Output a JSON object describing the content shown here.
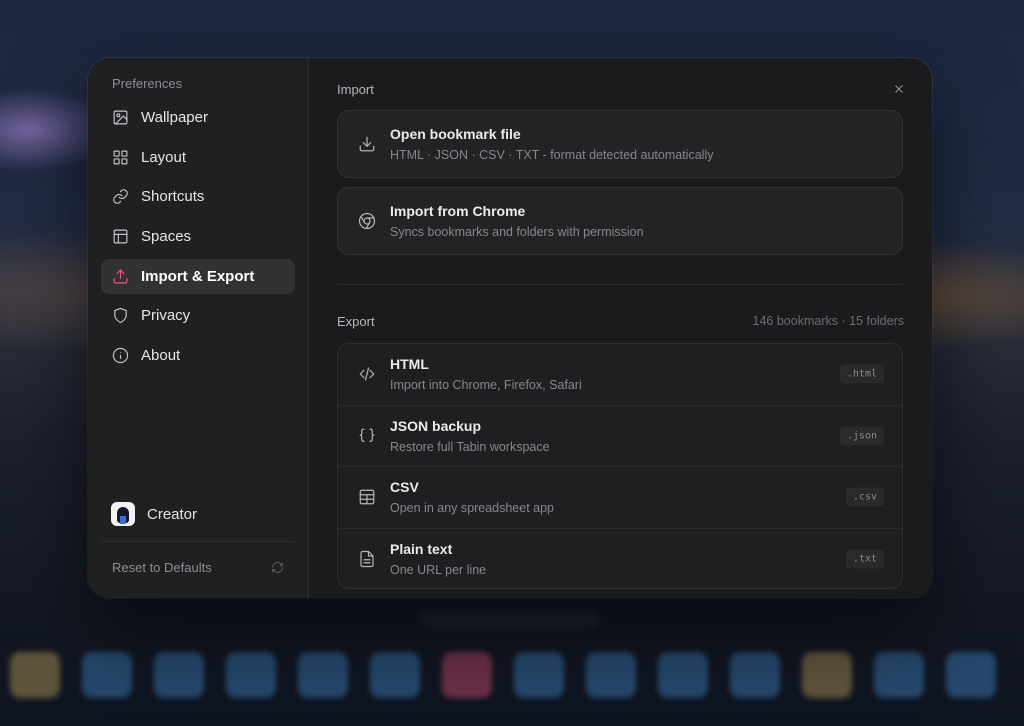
{
  "sidebar": {
    "title": "Preferences",
    "items": [
      {
        "label": "Wallpaper",
        "icon": "image-icon"
      },
      {
        "label": "Layout",
        "icon": "grid-icon"
      },
      {
        "label": "Shortcuts",
        "icon": "link-icon"
      },
      {
        "label": "Spaces",
        "icon": "layout-icon"
      },
      {
        "label": "Import & Export",
        "icon": "upload-icon",
        "active": true
      },
      {
        "label": "Privacy",
        "icon": "shield-icon"
      },
      {
        "label": "About",
        "icon": "info-icon"
      }
    ],
    "profile_name": "Creator",
    "reset_label": "Reset to Defaults"
  },
  "import": {
    "label": "Import",
    "options": [
      {
        "title": "Open bookmark file",
        "desc": "HTML · JSON · CSV · TXT - format detected automatically",
        "icon": "download-icon"
      },
      {
        "title": "Import from Chrome",
        "desc": "Syncs bookmarks and folders with permission",
        "icon": "chrome-icon"
      }
    ]
  },
  "export": {
    "label": "Export",
    "count": "146 bookmarks · 15 folders",
    "formats": [
      {
        "title": "HTML",
        "desc": "Import into Chrome, Firefox, Safari",
        "ext": ".html",
        "icon": "code-icon"
      },
      {
        "title": "JSON backup",
        "desc": "Restore full Tabin workspace",
        "ext": ".json",
        "icon": "braces-icon"
      },
      {
        "title": "CSV",
        "desc": "Open in any spreadsheet app",
        "ext": ".csv",
        "icon": "table-icon"
      },
      {
        "title": "Plain text",
        "desc": "One URL per line",
        "ext": ".txt",
        "icon": "file-text-icon"
      }
    ]
  },
  "colors": {
    "accent": "#ff4f7a",
    "panel": "#1b1b1d",
    "sidebar": "#202022"
  }
}
